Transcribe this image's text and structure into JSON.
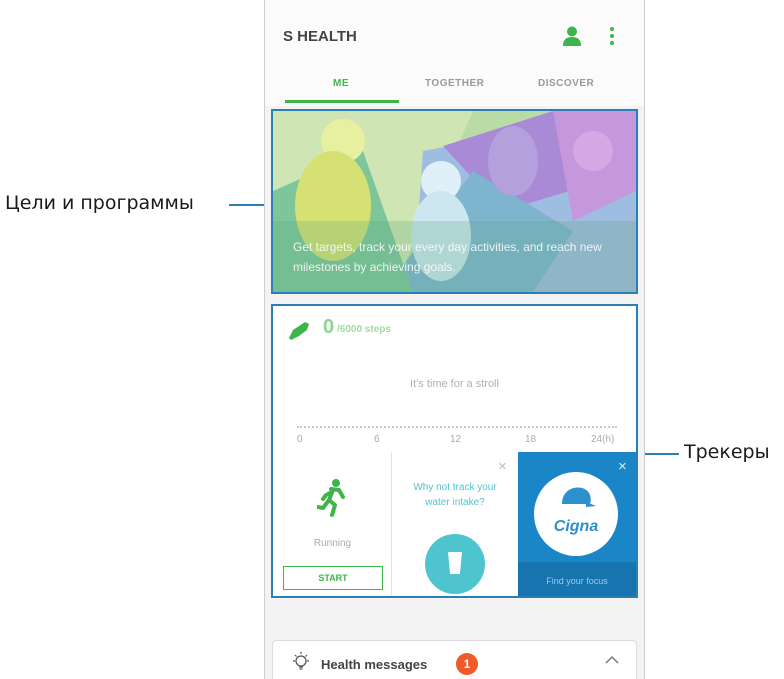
{
  "callouts": {
    "goals_label": "Цели и программы",
    "trackers_label": "Трекеры"
  },
  "app": {
    "title": "S HEALTH",
    "profile_icon": "profile-icon",
    "more_icon": "more-vertical-icon",
    "accent_color": "#3db54a"
  },
  "tabs": [
    {
      "label": "ME",
      "active": true
    },
    {
      "label": "TOGETHER",
      "active": false
    },
    {
      "label": "DISCOVER",
      "active": false
    }
  ],
  "banner": {
    "text": "Get targets, track your every day activities, and reach new milestones by achieving goals."
  },
  "steps": {
    "icon": "shoe-icon",
    "value": "0",
    "goal": "/6000 steps",
    "prompt": "It's time for a stroll",
    "ticks": [
      "0",
      "6",
      "12",
      "18",
      "24(h)"
    ]
  },
  "cards": {
    "running": {
      "label": "Running",
      "button": "START",
      "icon": "running-icon"
    },
    "water": {
      "text": "Why not track your water intake?",
      "icon": "cup-icon",
      "close": "×"
    },
    "cigna": {
      "brand": "Cigna",
      "subtitle": "Find your focus",
      "close": "×"
    }
  },
  "messages": {
    "icon": "lightbulb-icon",
    "label": "Health messages",
    "badge": "1",
    "chevron": "chevron-up-icon"
  }
}
